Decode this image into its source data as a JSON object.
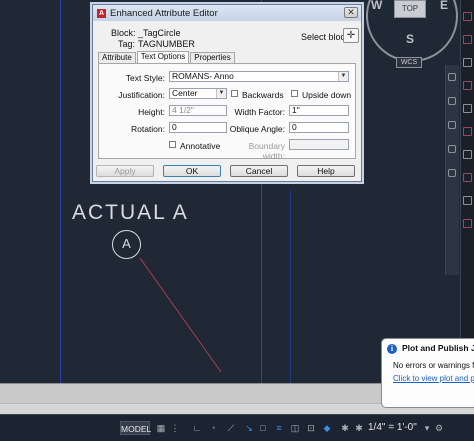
{
  "canvas": {
    "annotation_text": "ACTUAL A",
    "tag_circle_letter": "A",
    "viewcube": {
      "top_label": "TOP",
      "west": "W",
      "east": "E",
      "south": "S",
      "wcs_label": "WCS"
    }
  },
  "dialog": {
    "title": "Enhanced Attribute Editor",
    "block_label": "Block:",
    "block_value": "_TagCircle",
    "tag_label": "Tag:",
    "tag_value": "TAGNUMBER",
    "select_block_label": "Select block",
    "tabs": [
      "Attribute",
      "Text Options",
      "Properties"
    ],
    "active_tab": "Text Options",
    "text_options": {
      "text_style_label": "Text Style:",
      "text_style_value": "ROMANS- Anno",
      "justification_label": "Justification:",
      "justification_value": "Center",
      "backwards_label": "Backwards",
      "upside_down_label": "Upside down",
      "height_label": "Height:",
      "height_value": "4 1/2\"",
      "width_factor_label": "Width Factor:",
      "width_factor_value": "1\"",
      "rotation_label": "Rotation:",
      "rotation_value": "0",
      "oblique_angle_label": "Oblique Angle:",
      "oblique_angle_value": "0",
      "annotative_label": "Annotative",
      "boundary_width_label": "Boundary width:"
    },
    "buttons": {
      "apply": "Apply",
      "ok": "OK",
      "cancel": "Cancel",
      "help": "Help"
    }
  },
  "statusbar": {
    "model_label": "MODEL",
    "scale_label": "1/4\" = 1'-0\""
  },
  "notification": {
    "title": "Plot and Publish Job",
    "line1": "No errors or warnings fou",
    "link": "Click to view plot and pul"
  }
}
